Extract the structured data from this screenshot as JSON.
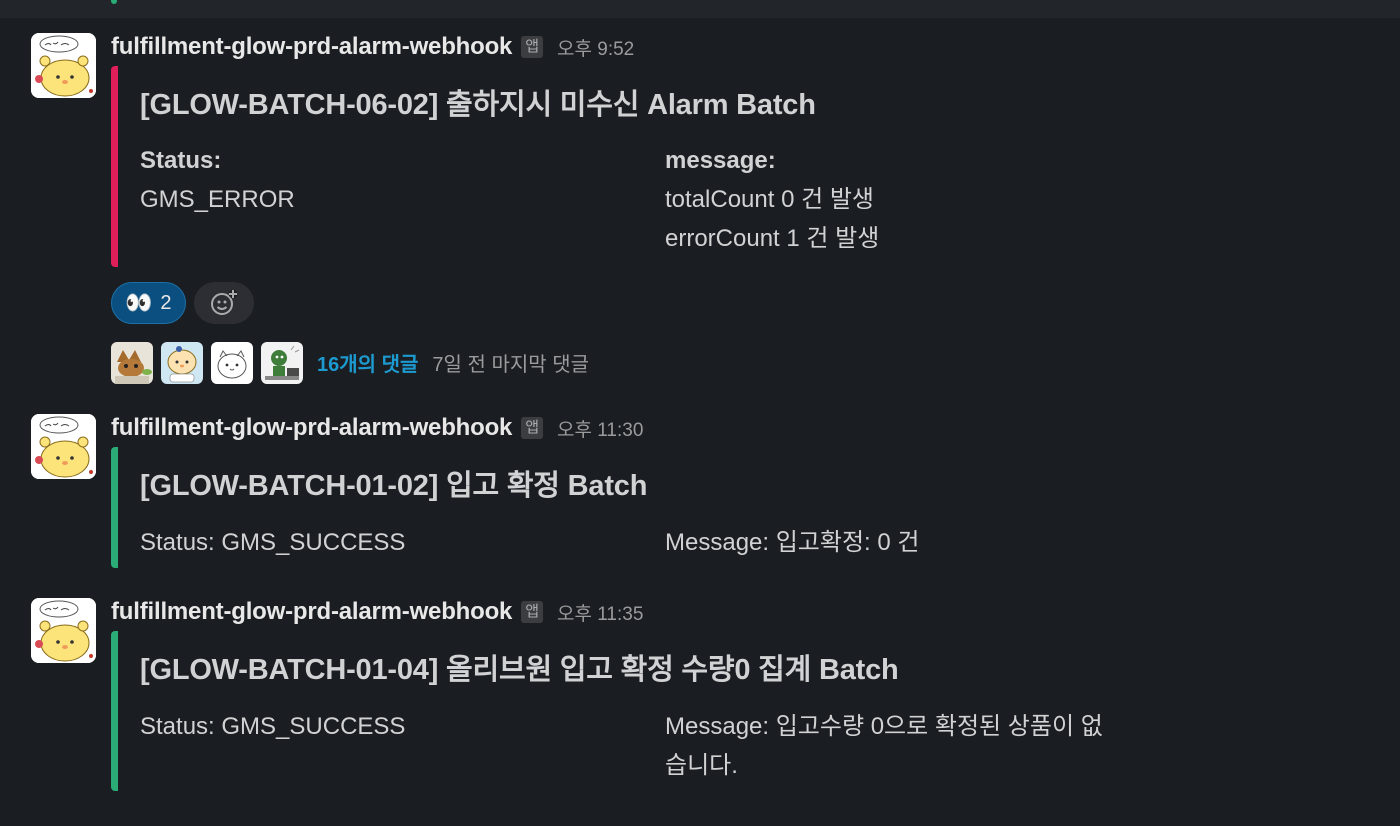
{
  "messages": [
    {
      "sender": "fulfillment-glow-prd-alarm-webhook",
      "badge": "앱",
      "time": "오후 9:52",
      "title": "[GLOW-BATCH-06-02] 출하지시 미수신 Alarm Batch",
      "accent": "#e01e5a",
      "fields": [
        {
          "label": "Status:",
          "lines": [
            "GMS_ERROR"
          ]
        },
        {
          "label": "message:",
          "lines": [
            "totalCount 0 건 발생",
            "errorCount 1 건 발생"
          ]
        }
      ],
      "reaction": {
        "icon": "eyes-emoji",
        "emoji": "👀",
        "count": "2"
      },
      "thread": {
        "replies": "16개의 댓글",
        "last": "7일 전 마지막 댓글"
      }
    },
    {
      "sender": "fulfillment-glow-prd-alarm-webhook",
      "badge": "앱",
      "time": "오후 11:30",
      "title": "[GLOW-BATCH-01-02] 입고 확정 Batch",
      "accent": "#2bac76",
      "fields": [
        {
          "text": "Status: GMS_SUCCESS"
        },
        {
          "text": "Message: 입고확정: 0 건"
        }
      ]
    },
    {
      "sender": "fulfillment-glow-prd-alarm-webhook",
      "badge": "앱",
      "time": "오후 11:35",
      "title": "[GLOW-BATCH-01-04] 올리브원 입고 확정 수량0 집계 Batch",
      "accent": "#2bac76",
      "fields": [
        {
          "text": "Status: GMS_SUCCESS"
        },
        {
          "lines": [
            "Message: 입고수량 0으로 확정된 상품이 없",
            "습니다."
          ]
        }
      ]
    }
  ],
  "colors": {
    "background": "#1a1d21",
    "link": "#1d9bd1",
    "error": "#e01e5a",
    "success": "#2bac76"
  }
}
